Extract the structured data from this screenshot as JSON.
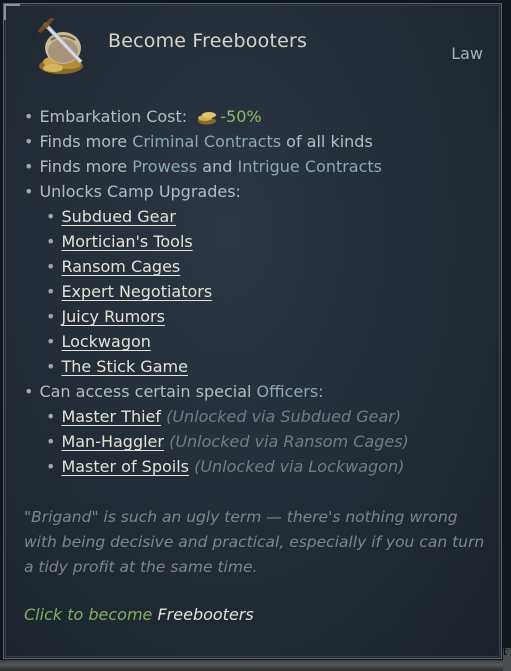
{
  "header": {
    "title": "Become Freebooters",
    "category": "Law",
    "icon": "sword-and-gold-coins-icon"
  },
  "effects": [
    {
      "prefix": "Embarkation Cost:",
      "value": "-50%",
      "icon": "gold-coins-icon"
    },
    {
      "prefix": "Finds more",
      "highlight": "Criminal Contracts",
      "suffix": "of all kinds"
    },
    {
      "prefix": "Finds more",
      "highlight": "Prowess",
      "middle": "and",
      "highlight2": "Intrigue Contracts"
    },
    {
      "prefix": "Unlocks Camp Upgrades:"
    }
  ],
  "camp_upgrades": [
    "Subdued Gear",
    "Mortician's Tools",
    "Ransom Cages",
    "Expert Negotiators",
    "Juicy Rumors",
    "Lockwagon",
    "The Stick Game"
  ],
  "officers_line": {
    "prefix": "Can access certain special",
    "highlight": "Officers:"
  },
  "officers": [
    {
      "name": "Master Thief",
      "note": "(Unlocked via Subdued Gear)"
    },
    {
      "name": "Man-Haggler",
      "note": "(Unlocked via Ransom Cages)"
    },
    {
      "name": "Master of Spoils",
      "note": "(Unlocked via Lockwagon)"
    }
  ],
  "flavor_text": "\"Brigand\" is such an ugly term — there's nothing wrong with being decisive and practical, especially if you can turn a tidy profit at the same time.",
  "footer": {
    "action": "Click to become",
    "target": "Freebooters"
  },
  "colors": {
    "link": "#e6e2d6",
    "highlight": "#8fa7b8",
    "positive": "#8bbf6a"
  },
  "partial_glyph": "t"
}
